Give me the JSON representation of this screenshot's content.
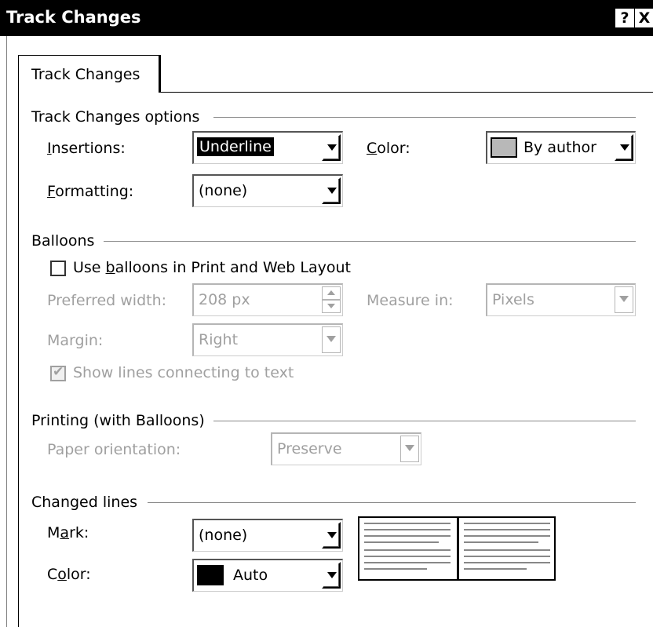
{
  "window": {
    "title": "Track Changes",
    "help_label": "?",
    "close_label": "X"
  },
  "tabs": [
    {
      "label": "Track Changes"
    }
  ],
  "track_changes_options": {
    "heading": "Track Changes options",
    "insertions": {
      "label": "Insertions:",
      "value": "Underline"
    },
    "color": {
      "label": "Color:",
      "value": "By author",
      "swatch": "#b8b8b8"
    },
    "formatting": {
      "label": "Formatting:",
      "value": "(none)"
    }
  },
  "balloons": {
    "heading": "Balloons",
    "use_balloons": {
      "label": "Use balloons in Print and Web Layout",
      "checked": false
    },
    "preferred_width": {
      "label": "Preferred width:",
      "value": "208 px"
    },
    "measure_in": {
      "label": "Measure in:",
      "value": "Pixels"
    },
    "margin": {
      "label": "Margin:",
      "value": "Right"
    },
    "show_lines": {
      "label": "Show lines connecting to text",
      "checked": true
    }
  },
  "printing": {
    "heading": "Printing (with Balloons)",
    "paper_orientation": {
      "label": "Paper orientation:",
      "value": "Preserve"
    }
  },
  "changed_lines": {
    "heading": "Changed lines",
    "mark": {
      "label": "Mark:",
      "value": "(none)"
    },
    "color": {
      "label": "Color:",
      "value": "Auto",
      "swatch": "#000000"
    }
  },
  "icons": {
    "dropdown": "chevron-down-icon",
    "spinner": "spinner-arrows-icon",
    "checkmark": "checkmark-icon"
  },
  "colors": {
    "titlebar": "#000000",
    "disabled_text": "#a0a0a0",
    "selection": "#000000"
  }
}
